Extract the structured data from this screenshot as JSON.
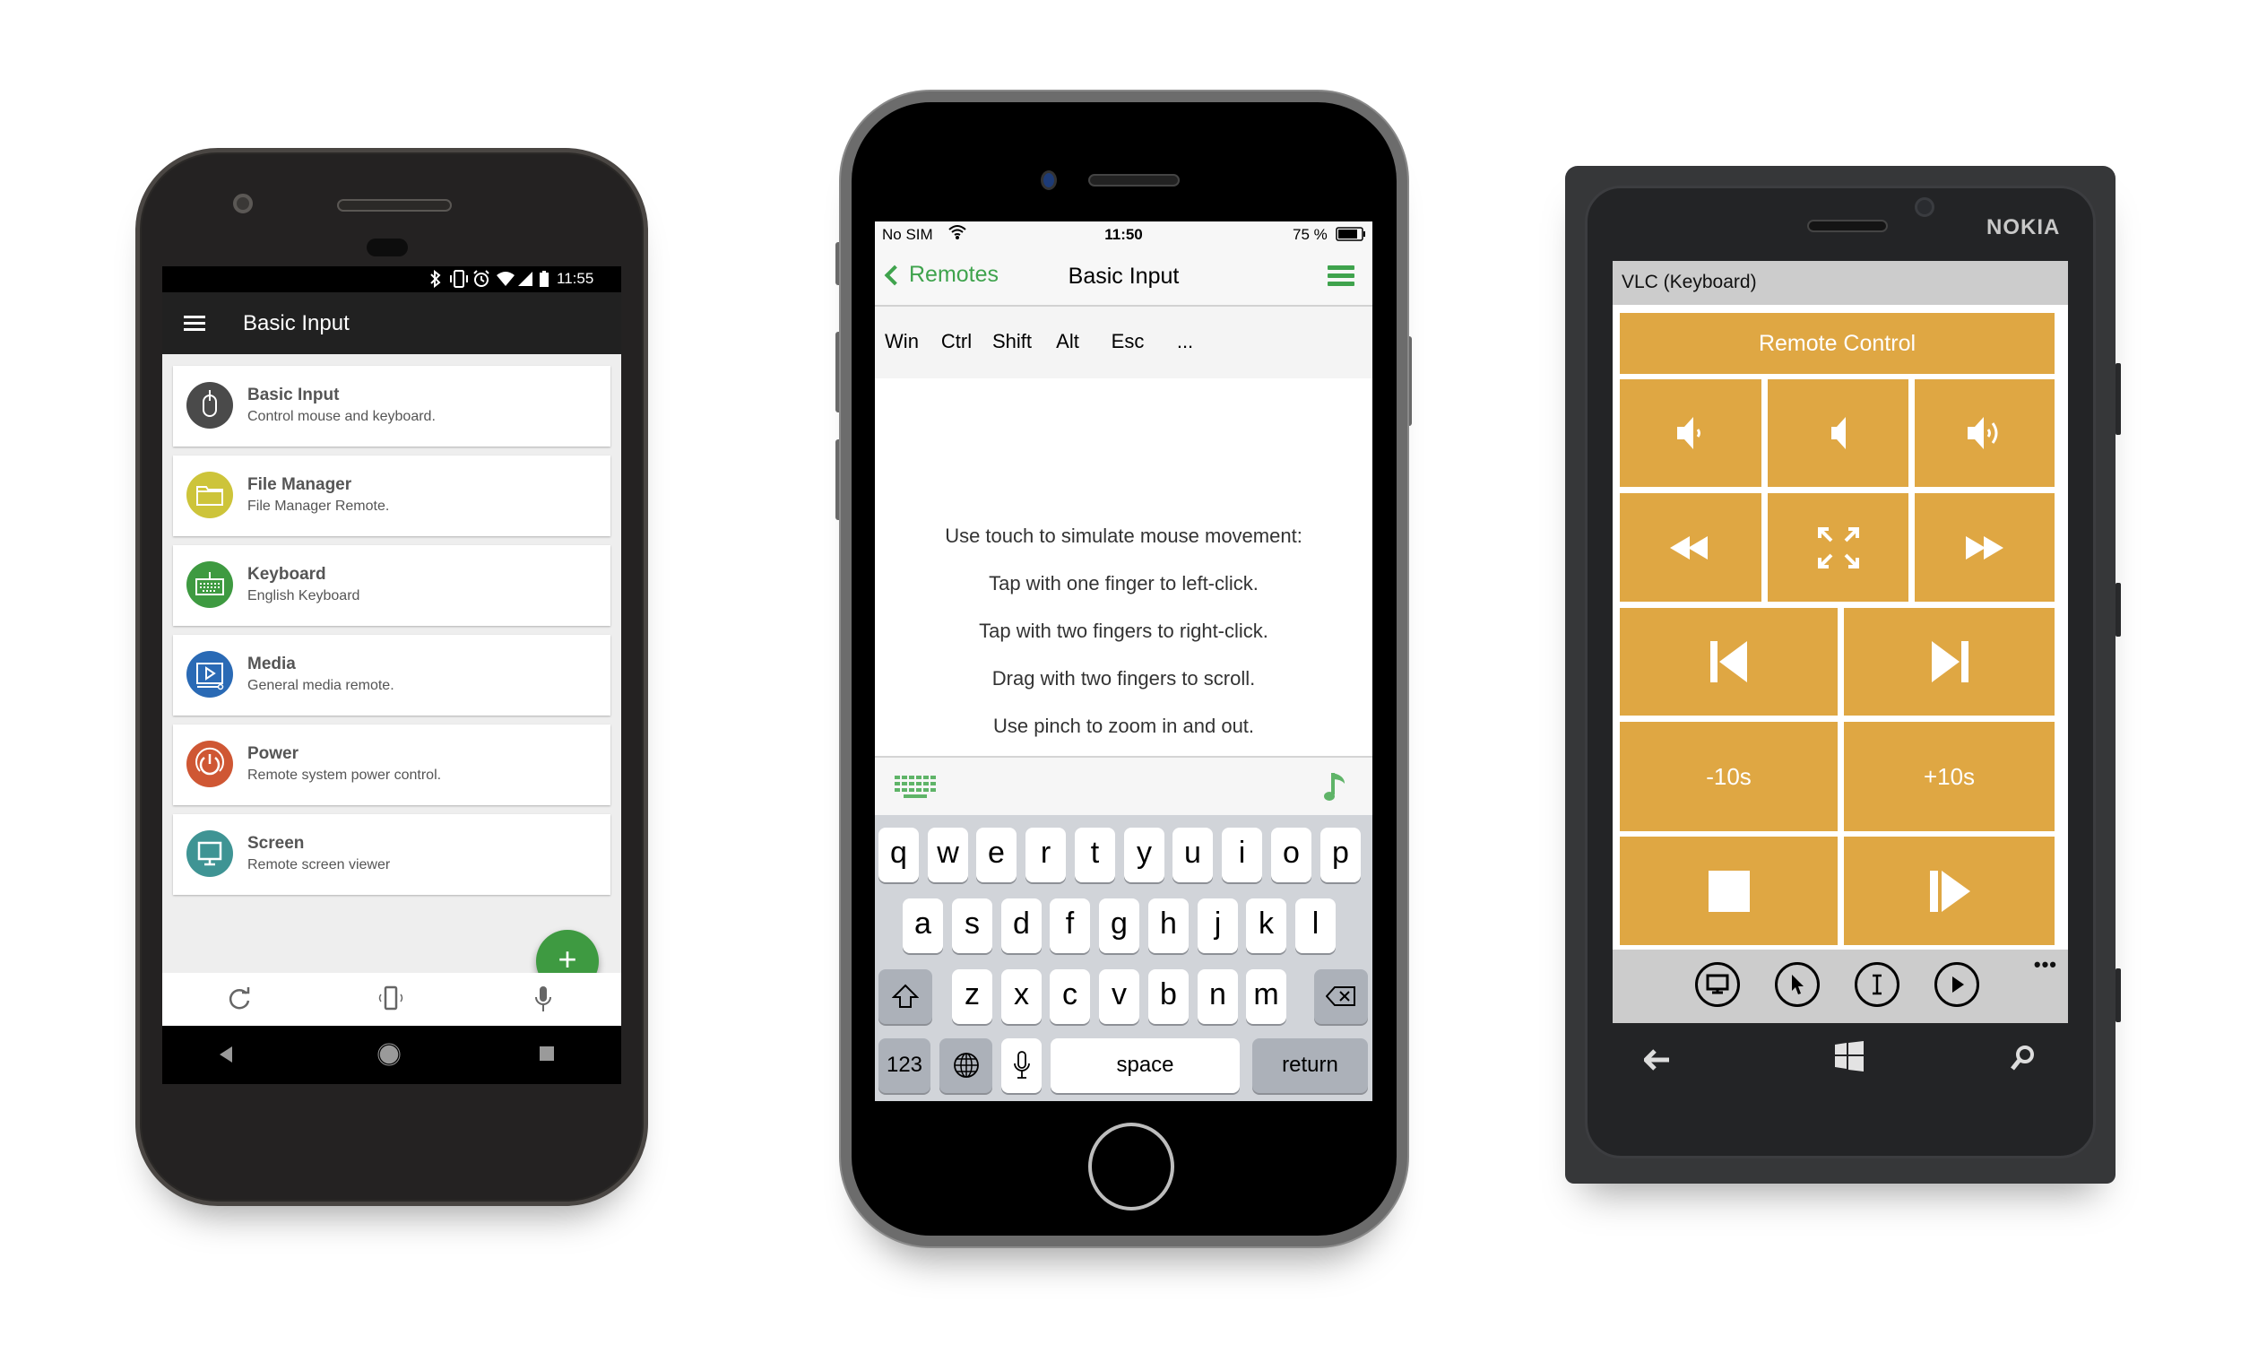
{
  "android": {
    "status_bar": {
      "time": "11:55",
      "icons": [
        "bluetooth-icon",
        "vibrate-icon",
        "alarm-icon",
        "wifi-icon",
        "signal-icon",
        "battery-icon"
      ]
    },
    "app_bar": {
      "title": "Basic Input",
      "menu_icon": "hamburger-menu-icon"
    },
    "remotes": [
      {
        "title": "Basic Input",
        "subtitle": "Control mouse and keyboard.",
        "icon": "mouse-icon",
        "color": "#4a4a4a"
      },
      {
        "title": "File Manager",
        "subtitle": "File Manager Remote.",
        "icon": "folder-icon",
        "color": "#cdc43a"
      },
      {
        "title": "Keyboard",
        "subtitle": "English Keyboard",
        "icon": "keyboard-icon",
        "color": "#3e9a41"
      },
      {
        "title": "Media",
        "subtitle": "General media remote.",
        "icon": "media-icon",
        "color": "#2a6ab5"
      },
      {
        "title": "Power",
        "subtitle": "Remote system power control.",
        "icon": "power-icon",
        "color": "#cf5734"
      },
      {
        "title": "Screen",
        "subtitle": "Remote screen viewer",
        "icon": "monitor-icon",
        "color": "#3f9494"
      }
    ],
    "fab_label": "+",
    "bottom_bar": [
      "refresh-icon",
      "vibrate-phone-icon",
      "microphone-icon"
    ],
    "nav_bar": [
      "back-icon",
      "home-icon",
      "recents-icon"
    ]
  },
  "iphone": {
    "status_bar": {
      "carrier": "No SIM",
      "time": "11:50",
      "battery": "75 %"
    },
    "nav": {
      "back_label": "Remotes",
      "title": "Basic Input"
    },
    "modifiers": [
      "Win",
      "Ctrl",
      "Shift",
      "Alt",
      "Esc",
      "..."
    ],
    "instructions": [
      "Use touch to simulate mouse movement:",
      "Tap with one finger to left-click.",
      "Tap with two fingers to right-click.",
      "Drag with two fingers to scroll.",
      "Use pinch to zoom in and out."
    ],
    "keyboard": {
      "row1": [
        "q",
        "w",
        "e",
        "r",
        "t",
        "y",
        "u",
        "i",
        "o",
        "p"
      ],
      "row2": [
        "a",
        "s",
        "d",
        "f",
        "g",
        "h",
        "j",
        "k",
        "l"
      ],
      "row3": [
        "z",
        "x",
        "c",
        "v",
        "b",
        "n",
        "m"
      ],
      "numbers_label": "123",
      "space_label": "space",
      "return_label": "return"
    },
    "accent_color": "#3fa34d"
  },
  "nokia": {
    "brand": "NOKIA",
    "header": "VLC (Keyboard)",
    "title_tile": "Remote Control",
    "tiles": {
      "volume_down": "volume-down-icon",
      "mute": "mute-icon",
      "volume_up": "volume-up-icon",
      "rewind": "rewind-icon",
      "fullscreen": "fullscreen-icon",
      "fast_forward": "fast-forward-icon",
      "previous": "skip-previous-icon",
      "next": "skip-next-icon",
      "back_10": "-10s",
      "forward_10": "+10s",
      "stop": "stop-icon",
      "play_pause": "play-pause-icon"
    },
    "app_bar": [
      "screen-icon",
      "cursor-icon",
      "text-cursor-icon",
      "play-icon"
    ],
    "more_label": "•••",
    "accent_color": "#dfa743"
  }
}
